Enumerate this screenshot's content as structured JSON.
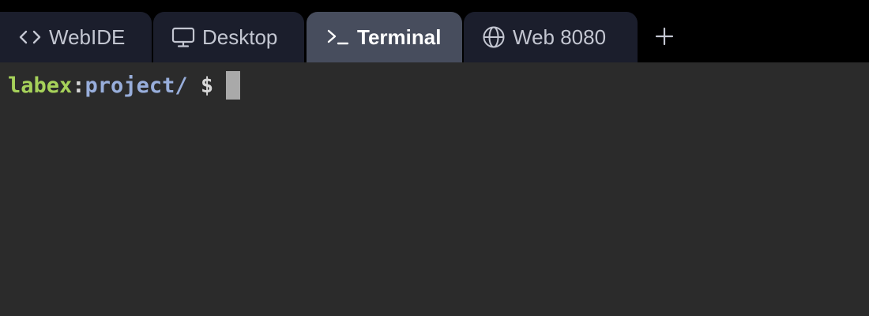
{
  "tabs": [
    {
      "id": "webide",
      "label": "WebIDE",
      "icon": "code-brackets-icon",
      "active": false
    },
    {
      "id": "desktop",
      "label": "Desktop",
      "icon": "monitor-icon",
      "active": false
    },
    {
      "id": "terminal",
      "label": "Terminal",
      "icon": "terminal-prompt-icon",
      "active": true
    },
    {
      "id": "web",
      "label": "Web 8080",
      "icon": "globe-icon",
      "active": false
    }
  ],
  "add_tab": {
    "icon": "plus-icon"
  },
  "terminal": {
    "prompt_user": "labex",
    "prompt_separator": ":",
    "prompt_path": "project/",
    "prompt_symbol": "$"
  },
  "colors": {
    "tabbar_background": "#000000",
    "tab_background": "#1b1e2c",
    "tab_active_background": "#474d5d",
    "terminal_background": "#2b2b2b",
    "prompt_user": "#a6d15a",
    "prompt_path": "#98aedb",
    "cursor": "#a9a9a9"
  }
}
